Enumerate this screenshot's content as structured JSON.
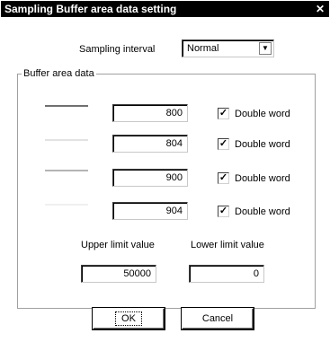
{
  "dialog": {
    "title": "Sampling Buffer area data setting",
    "close_glyph": "✕"
  },
  "sampling": {
    "label": "Sampling interval",
    "value": "Normal"
  },
  "buffer": {
    "group_label": "Buffer area data",
    "rows": [
      {
        "line_color": "#707070",
        "value": "800",
        "checked": true,
        "checkbox_label": "Double word",
        "check_glyph": "✓"
      },
      {
        "line_color": "#e2e2e2",
        "value": "804",
        "checked": true,
        "checkbox_label": "Double word",
        "check_glyph": "✓"
      },
      {
        "line_color": "#b4b4b4",
        "value": "900",
        "checked": true,
        "checkbox_label": "Double word",
        "check_glyph": "✓"
      },
      {
        "line_color": "#f0f0f0",
        "value": "904",
        "checked": true,
        "checkbox_label": "Double word",
        "check_glyph": "✓"
      }
    ]
  },
  "limits": {
    "upper_label": "Upper limit value",
    "upper_value": "50000",
    "lower_label": "Lower limit value",
    "lower_value": "0"
  },
  "buttons": {
    "ok_label": "OK",
    "cancel_label": "Cancel"
  },
  "icons": {
    "dropdown": "chevron-down-icon",
    "close": "close-icon",
    "check": "check-icon"
  }
}
